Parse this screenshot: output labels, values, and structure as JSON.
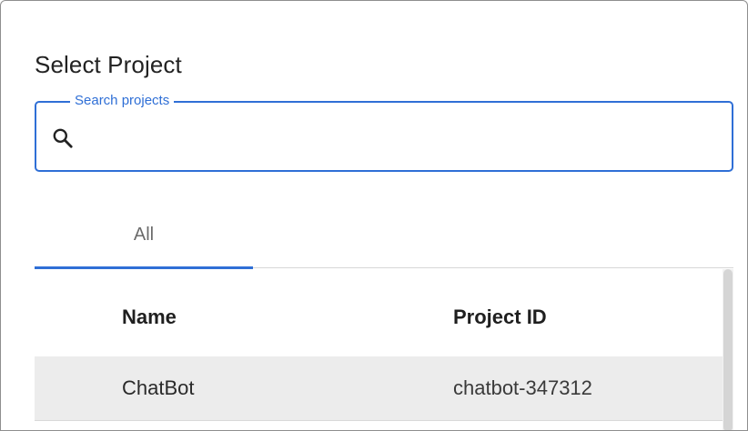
{
  "dialog": {
    "title": "Select Project"
  },
  "search": {
    "label": "Search projects",
    "value": "",
    "placeholder": "",
    "icon": "search-icon"
  },
  "tabs": [
    {
      "label": "All",
      "selected": true
    }
  ],
  "table": {
    "columns": [
      "Name",
      "Project ID"
    ],
    "rows": [
      {
        "name": "ChatBot",
        "project_id": "chatbot-347312"
      }
    ]
  },
  "colors": {
    "accent": "#2f6fd6",
    "row_highlight": "#ececec",
    "text": "#222222",
    "muted": "#6b6b6b"
  }
}
